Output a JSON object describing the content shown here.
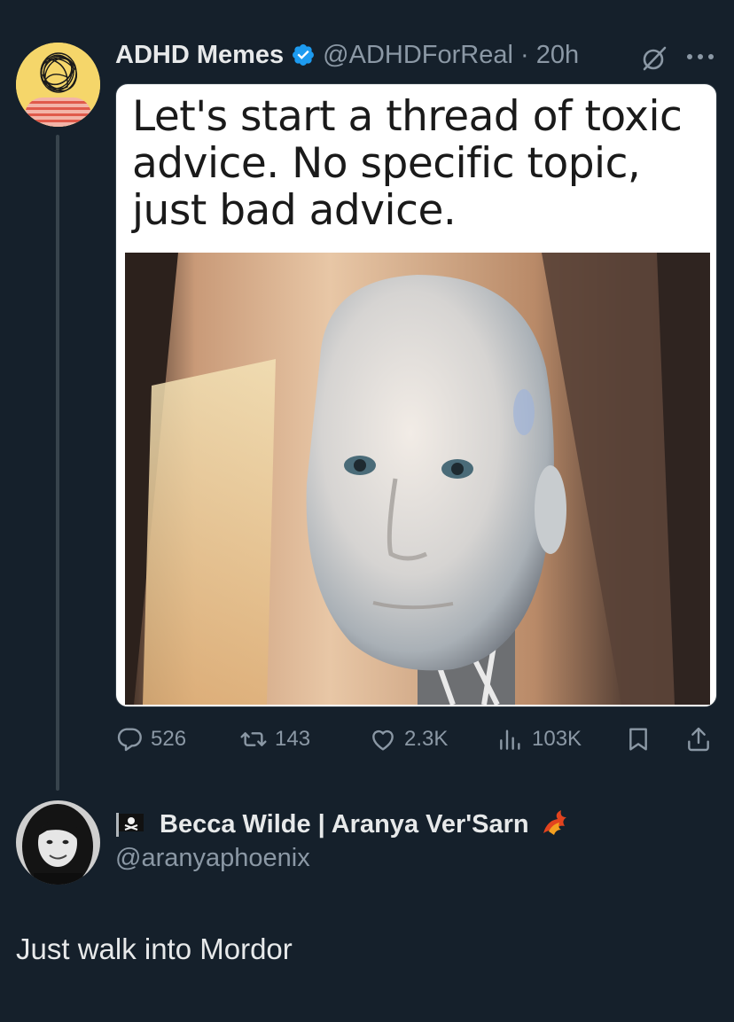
{
  "tweet": {
    "display_name": "ADHD Memes",
    "handle_time": "@ADHDForReal · 20h",
    "verified": true,
    "meme_text": "Let's start a thread of toxic advice. No specific topic, just bad advice.",
    "actions": {
      "replies": "526",
      "retweets": "143",
      "likes": "2.3K",
      "views": "103K"
    }
  },
  "reply": {
    "display_name": "Becca Wilde | Aranya Ver'Sarn",
    "handle": "@aranyaphoenix",
    "text": "Just walk into Mordor"
  },
  "colors": {
    "background": "#15202b",
    "primary_text": "#e7e9ea",
    "secondary_text": "#8b98a5",
    "verified_blue": "#1d9bf0",
    "thread_line": "#38444d"
  },
  "icons": [
    "verified-badge-icon",
    "grok-icon",
    "more-icon",
    "reply-icon",
    "retweet-icon",
    "like-icon",
    "views-icon",
    "bookmark-icon",
    "share-icon",
    "pirate-flag-icon",
    "phoenix-icon"
  ]
}
